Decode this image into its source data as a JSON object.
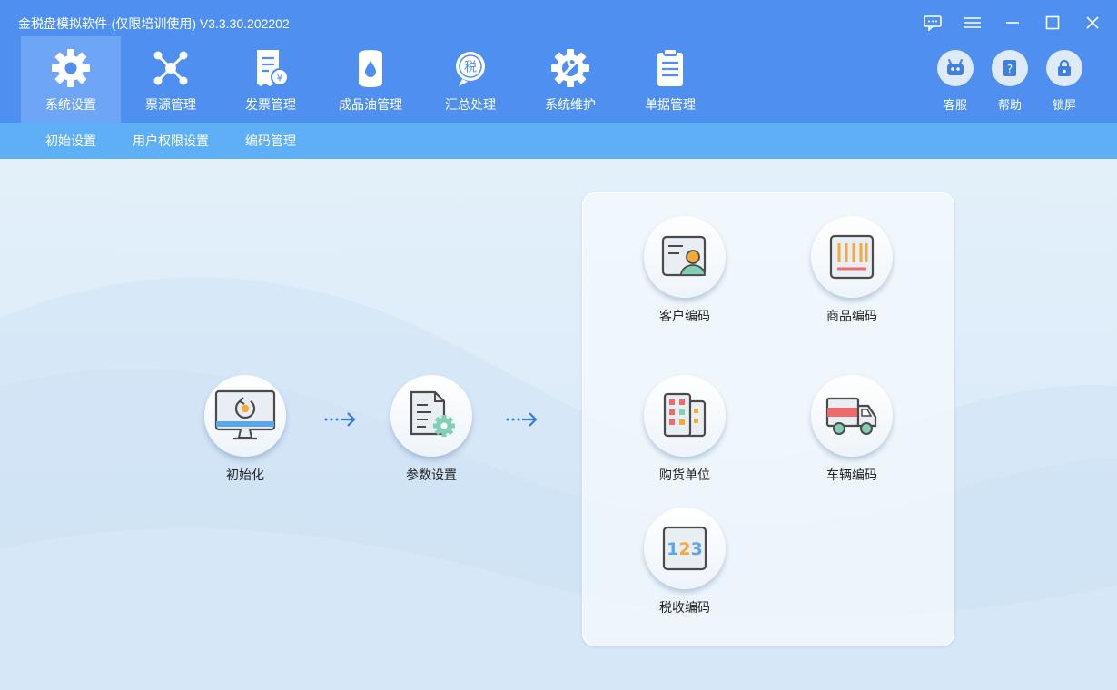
{
  "window": {
    "title": "金税盘模拟软件-(仅限培训使用) V3.3.30.202202"
  },
  "nav": {
    "items": [
      {
        "label": "系统设置",
        "icon": "gear-icon"
      },
      {
        "label": "票源管理",
        "icon": "network-icon"
      },
      {
        "label": "发票管理",
        "icon": "invoice-icon"
      },
      {
        "label": "成品油管理",
        "icon": "oil-barrel-icon"
      },
      {
        "label": "汇总处理",
        "icon": "tax-summary-icon"
      },
      {
        "label": "系统维护",
        "icon": "wrench-gear-icon"
      },
      {
        "label": "单据管理",
        "icon": "clipboard-icon"
      }
    ]
  },
  "side": {
    "service": "客服",
    "help": "帮助",
    "lock": "锁屏"
  },
  "subnav": {
    "items": [
      "初始设置",
      "用户权限设置",
      "编码管理"
    ]
  },
  "flow": {
    "init": "初始化",
    "params": "参数设置"
  },
  "codes": {
    "customer": "客户编码",
    "goods": "商品编码",
    "supplier": "购货单位",
    "vehicle": "车辆编码",
    "tax": "税收编码",
    "tax_digits": "123"
  },
  "colors": {
    "topbar": "#4e8ff0",
    "subnav": "#5eaff5",
    "active_tab": "#6ea6f5",
    "arrow": "#3a7ad8"
  }
}
